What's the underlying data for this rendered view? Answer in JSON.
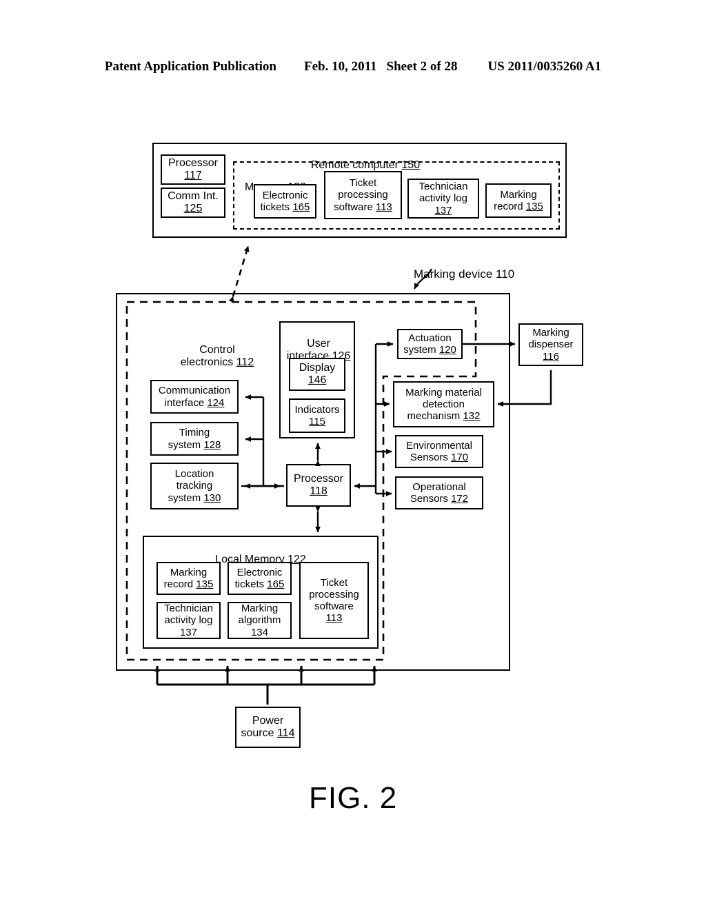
{
  "header": {
    "publication": "Patent Application Publication",
    "date": "Feb. 10, 2011",
    "sheet": "Sheet 2 of 28",
    "patent_number": "US 2011/0035260 A1"
  },
  "figure": {
    "caption": "FIG. 2"
  },
  "remote_computer": {
    "title": "Remote computer",
    "ref": "150",
    "processor": {
      "line1": "Processor",
      "ref": "117"
    },
    "comm_int": {
      "line1": "Comm Int.",
      "ref": "125"
    },
    "memory": {
      "label": "Memory 123"
    },
    "electronic_tickets": {
      "line1": "Electronic",
      "line2": "tickets",
      "ref": "165"
    },
    "ticket_processing_software": {
      "line1": "Ticket",
      "line2": "processing",
      "line3": "software",
      "ref": "113"
    },
    "technician_activity_log": {
      "line1": "Technician",
      "line2": "activity log",
      "ref": "137"
    },
    "marking_record": {
      "line1": "Marking",
      "line2": "record",
      "ref": "135"
    }
  },
  "marking_device": {
    "callout": "Marking device 110",
    "control_electronics": {
      "line1": "Control",
      "line2": "electronics",
      "ref": "112"
    },
    "user_interface": {
      "line1": "User",
      "line2": "interface",
      "ref": "126"
    },
    "display": {
      "line1": "Display",
      "ref": "146"
    },
    "indicators": {
      "line1": "Indicators",
      "ref": "115"
    },
    "communication_interface": {
      "line1": "Communication",
      "line2": "interface",
      "ref": "124"
    },
    "timing_system": {
      "line1": "Timing",
      "line2": "system",
      "ref": "128"
    },
    "location_tracking_system": {
      "line1": "Location",
      "line2": "tracking",
      "line3": "system",
      "ref": "130"
    },
    "processor": {
      "line1": "Processor",
      "ref": "118"
    },
    "actuation_system": {
      "line1": "Actuation",
      "line2": "system",
      "ref": "120"
    },
    "marking_dispenser": {
      "line1": "Marking",
      "line2": "dispenser",
      "ref": "116"
    },
    "marking_material_detection": {
      "line1": "Marking material",
      "line2": "detection",
      "line3": "mechanism",
      "ref": "132"
    },
    "environmental_sensors": {
      "line1": "Environmental",
      "line2": "Sensors",
      "ref": "170"
    },
    "operational_sensors": {
      "line1": "Operational",
      "line2": "Sensors",
      "ref": "172"
    },
    "local_memory": {
      "title": "Local Memory",
      "ref": "122"
    },
    "lm_marking_record": {
      "line1": "Marking",
      "line2": "record",
      "ref": "135"
    },
    "lm_electronic_tickets": {
      "line1": "Electronic",
      "line2": "tickets",
      "ref": "165"
    },
    "lm_ticket_processing_software": {
      "line1": "Ticket",
      "line2": "processing",
      "line3": "software",
      "ref": "113"
    },
    "lm_technician_activity_log": {
      "line1": "Technician",
      "line2": "activity log",
      "ref": "137"
    },
    "lm_marking_algorithm": {
      "line1": "Marking",
      "line2": "algorithm",
      "ref": "134"
    },
    "power_source": {
      "line1": "Power",
      "line2": "source",
      "ref": "114"
    }
  },
  "colors": {
    "ink": "#000000",
    "paper": "#ffffff"
  }
}
